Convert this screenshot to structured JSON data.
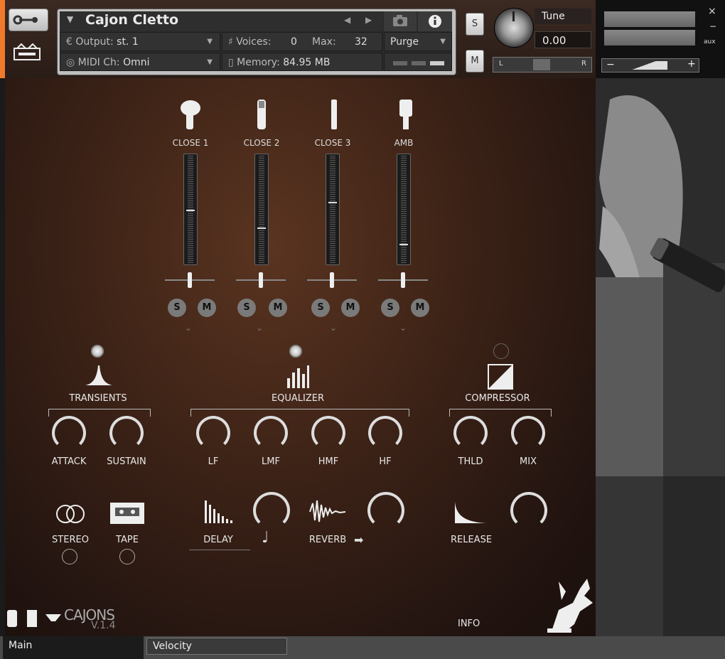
{
  "header": {
    "instrument_name": "Cajon Cletto",
    "output_label": "Output:",
    "output_value": "st. 1",
    "voices_label": "Voices:",
    "voices_value": "0",
    "max_label": "Max:",
    "max_value": "32",
    "purge_label": "Purge",
    "midi_label": "MIDI Ch:",
    "midi_value": "Omni",
    "memory_label": "Memory:",
    "memory_value": "84.95 MB",
    "solo_label": "S",
    "mute_label": "M",
    "tune_label": "Tune",
    "tune_value": "0.00",
    "pan_left": "L",
    "pan_right": "R",
    "aux_label": "aux",
    "close_glyph": "×",
    "minus_glyph": "−",
    "plus_glyph": "+"
  },
  "mixer": {
    "channels": [
      {
        "name": "CLOSE 1",
        "level": 0.5,
        "solo": "S",
        "mute": "M"
      },
      {
        "name": "CLOSE 2",
        "level": 0.33,
        "solo": "S",
        "mute": "M"
      },
      {
        "name": "CLOSE 3",
        "level": 0.57,
        "solo": "S",
        "mute": "M"
      },
      {
        "name": "AMB",
        "level": 0.18,
        "solo": "S",
        "mute": "M"
      }
    ]
  },
  "fx": {
    "transients": {
      "title": "TRANSIENTS",
      "knobs": [
        "ATTACK",
        "SUSTAIN"
      ],
      "enabled": true
    },
    "equalizer": {
      "title": "EQUALIZER",
      "knobs": [
        "LF",
        "LMF",
        "HMF",
        "HF"
      ],
      "enabled": true
    },
    "compressor": {
      "title": "COMPRESSOR",
      "knobs": [
        "THLD",
        "MIX"
      ],
      "enabled": false
    },
    "stereo_label": "STEREO",
    "tape_label": "TAPE",
    "delay_label": "DELAY",
    "reverb_label": "REVERB",
    "release_label": "RELEASE",
    "note_glyph": "♩",
    "arrow_glyph": "➡"
  },
  "footer": {
    "brand": "CAJONS",
    "version": "V.1.4",
    "info_label": "INFO"
  },
  "tabs": [
    {
      "label": "Main"
    },
    {
      "label": "Velocity"
    }
  ],
  "colors": {
    "accent": "#f07a2a",
    "panel_brown": "#3a2116"
  }
}
